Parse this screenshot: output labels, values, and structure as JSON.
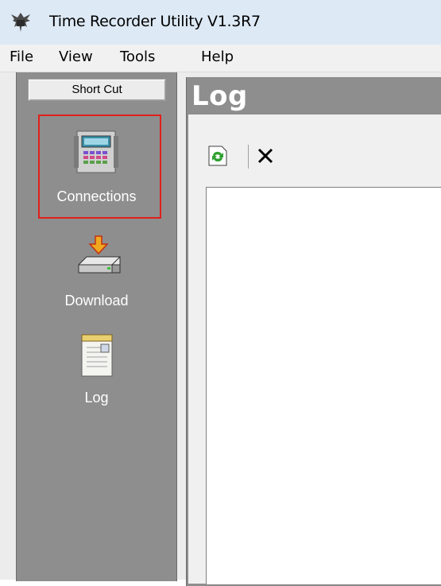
{
  "window": {
    "title": "Time Recorder Utility V1.3R7"
  },
  "menu": {
    "file": "File",
    "view": "View",
    "tools": "Tools",
    "help": "Help"
  },
  "sidebar": {
    "header": "Short Cut",
    "items": [
      {
        "label": "Connections",
        "icon": "terminal-device-icon",
        "selected": true
      },
      {
        "label": "Download",
        "icon": "download-device-icon",
        "selected": false
      },
      {
        "label": "Log",
        "icon": "log-notepad-icon",
        "selected": false
      }
    ]
  },
  "main": {
    "title": "Log",
    "toolbar": {
      "refresh": "refresh-icon",
      "delete": "delete-icon"
    },
    "log_content": ""
  },
  "colors": {
    "sidebar_bg": "#8e8e8e",
    "selected_border": "#e0201c",
    "titlebar_bg": "#dde9f5"
  }
}
